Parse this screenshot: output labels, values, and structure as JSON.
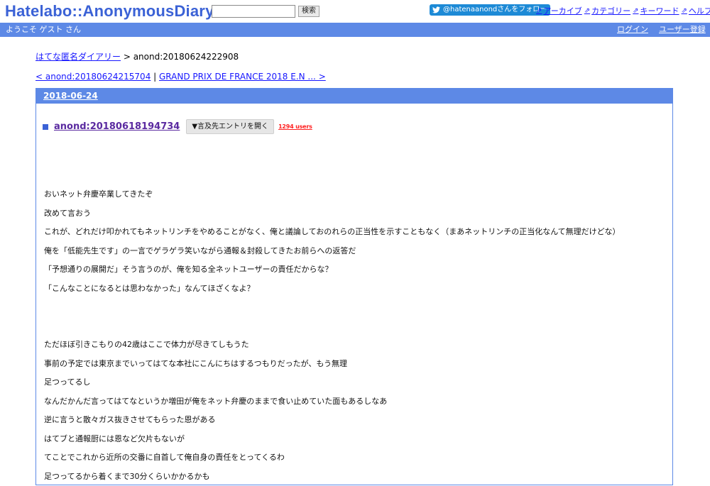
{
  "header": {
    "logo": "Hatelabo::AnonymousDiary",
    "search_value": "",
    "search_button": "検索",
    "twitter_follow": "@hatenaanondさんをフォロー",
    "nav": [
      {
        "label": "アーカイブ"
      },
      {
        "label": "カテゴリー"
      },
      {
        "label": "キーワード"
      },
      {
        "label": "ヘルプ"
      }
    ]
  },
  "bluebar": {
    "welcome": "ようこそ ゲスト さん",
    "login": "ログイン",
    "register": "ユーザー登録"
  },
  "breadcrumb": {
    "home": "はてな匿名ダイアリー",
    "separator": " > ",
    "current": "anond:20180624222908"
  },
  "pager": {
    "prev": "< anond:20180624215704",
    "separator": " | ",
    "next": "GRAND PRIX DE FRANCE 2018 E.N ... >"
  },
  "day": {
    "date": "2018-06-24",
    "entry_title": "anond:20180618194734",
    "ref_button": "▼言及先エントリを開く",
    "users": "1294 users"
  },
  "body": {
    "para1": [
      "おいネット弁慶卒業してきたぞ",
      "改めて言おう",
      "これが、どれだけ叩かれてもネットリンチをやめることがなく、俺と議論しておのれらの正当性を示すこともなく（まあネットリンチの正当化なんて無理だけどな）",
      "俺を「低能先生です」の一言でゲラゲラ笑いながら通報＆封殺してきたお前らへの返答だ",
      "「予想通りの展開だ」そう言うのが、俺を知る全ネットユーザーの責任だからな？",
      "「こんなことになるとは思わなかった」なんてほざくなよ？"
    ],
    "para2": [
      "ただほぼ引きこもりの42歳はここで体力が尽きてしもうた",
      "事前の予定では東京までいってはてな本社にこんにちはするつもりだったが、もう無理",
      "足つってるし",
      "なんだかんだ言ってはてなというか増田が俺をネット弁慶のままで食い止めていた面もあるしなあ",
      "逆に言うと散々ガス抜きさせてもらった恩がある",
      "はてブと通報厨には恩など欠片もないが",
      "てことでこれから近所の交番に自首して俺自身の責任をとってくるわ",
      "足つってるから着くまで30分くらいかかるかも"
    ]
  }
}
